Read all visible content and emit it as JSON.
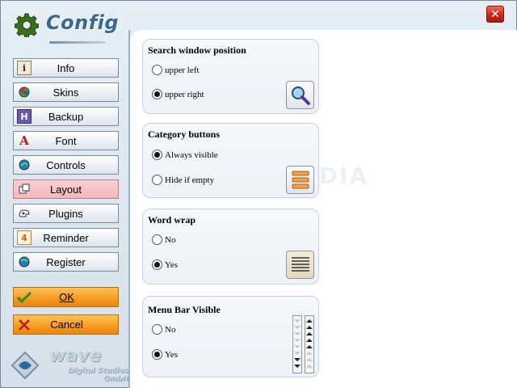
{
  "window": {
    "title": "Config",
    "close_glyph": "✕",
    "watermark": "SOFTPEDIA",
    "colors": {
      "accent": "#3a6a8a",
      "active_nav": "#f2b8bd",
      "action": "#f59a1e"
    }
  },
  "sidebar": {
    "items": [
      {
        "label": "Info",
        "icon": "info-icon",
        "glyph": "i"
      },
      {
        "label": "Skins",
        "icon": "skins-icon",
        "glyph": "●"
      },
      {
        "label": "Backup",
        "icon": "backup-icon",
        "glyph": "H"
      },
      {
        "label": "Font",
        "icon": "font-icon",
        "glyph": "A"
      },
      {
        "label": "Controls",
        "icon": "controls-icon",
        "glyph": "●"
      },
      {
        "label": "Layout",
        "icon": "layout-icon",
        "glyph": "⧉",
        "active": true
      },
      {
        "label": "Plugins",
        "icon": "plugins-icon",
        "glyph": "⚙"
      },
      {
        "label": "Reminder",
        "icon": "reminder-icon",
        "glyph": "4"
      },
      {
        "label": "Register",
        "icon": "register-icon",
        "glyph": "●"
      }
    ],
    "ok_label": "OK",
    "cancel_label": "Cancel",
    "ok_icon": "checkmark-icon",
    "cancel_icon": "x-icon"
  },
  "logo": {
    "name": "wave",
    "subtitle": "Digital Studios GmbH"
  },
  "sections": {
    "search_window_position": {
      "title": "Search window position",
      "options": [
        "upper left",
        "upper right"
      ],
      "selected": "upper right",
      "icon": "magnifier-icon"
    },
    "category_buttons": {
      "title": "Category buttons",
      "options": [
        "Always visible",
        "Hide if empty"
      ],
      "selected": "Always visible",
      "icon": "category-list-icon"
    },
    "word_wrap": {
      "title": "Word wrap",
      "options": [
        "No",
        "Yes"
      ],
      "selected": "Yes",
      "icon": "text-lines-icon"
    },
    "menu_bar_visible": {
      "title": "Menu Bar Visible",
      "options": [
        "No",
        "Yes"
      ],
      "selected": "Yes",
      "icon": "scroll-arrows-icon"
    }
  }
}
